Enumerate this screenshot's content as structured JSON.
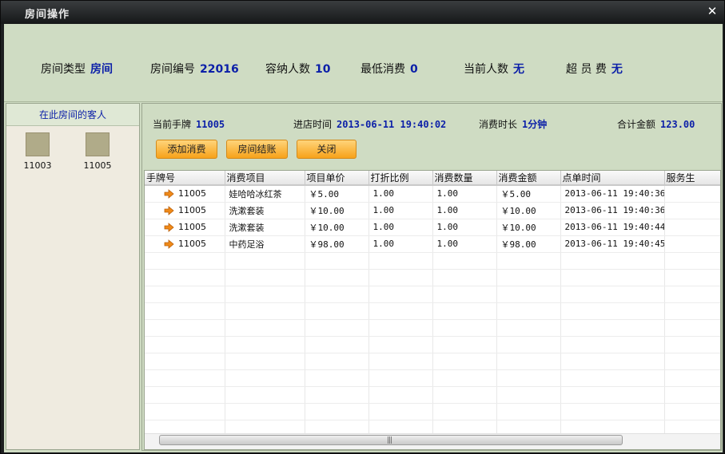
{
  "window": {
    "title": "房间操作",
    "close_glyph": "✕"
  },
  "room_info": {
    "type_label": "房间类型",
    "type_value": "房间",
    "number_label": "房间编号",
    "number_value": "22016",
    "capacity_label": "容纳人数",
    "capacity_value": "10",
    "min_spend_label": "最低消费",
    "min_spend_value": "0",
    "current_people_label": "当前人数",
    "current_people_value": "无",
    "overage_label": "超 员 费",
    "overage_value": "无"
  },
  "guests": {
    "header": "在此房间的客人",
    "items": [
      {
        "id": "11003"
      },
      {
        "id": "11005"
      }
    ]
  },
  "current": {
    "card_label": "当前手牌",
    "card_value": "11005",
    "checkin_label": "进店时间",
    "checkin_value": "2013-06-11 19:40:02",
    "duration_label": "消费时长",
    "duration_value": "1分钟",
    "total_label": "合计金额",
    "total_value": "123.00"
  },
  "buttons": {
    "add": "添加消费",
    "checkout": "房间结账",
    "close": "关闭"
  },
  "table": {
    "columns": [
      "手牌号",
      "消费项目",
      "项目单价",
      "打折比例",
      "消费数量",
      "消费金额",
      "点单时间",
      "服务生"
    ],
    "rows": [
      {
        "card": "11005",
        "item": "娃哈哈冰红茶",
        "price": "￥5.00",
        "discount": "1.00",
        "qty": "1.00",
        "amount": "￥5.00",
        "time": "2013-06-11 19:40:36",
        "waiter": ""
      },
      {
        "card": "11005",
        "item": "洗漱套装",
        "price": "￥10.00",
        "discount": "1.00",
        "qty": "1.00",
        "amount": "￥10.00",
        "time": "2013-06-11 19:40:36",
        "waiter": ""
      },
      {
        "card": "11005",
        "item": "洗漱套装",
        "price": "￥10.00",
        "discount": "1.00",
        "qty": "1.00",
        "amount": "￥10.00",
        "time": "2013-06-11 19:40:44",
        "waiter": ""
      },
      {
        "card": "11005",
        "item": "中药足浴",
        "price": "￥98.00",
        "discount": "1.00",
        "qty": "1.00",
        "amount": "￥98.00",
        "time": "2013-06-11 19:40:45",
        "waiter": ""
      }
    ],
    "scroll_grip": "|||"
  },
  "colors": {
    "accent_value": "#0b1fa8",
    "button": "#f7a21a",
    "background": "#cfdcc3"
  },
  "icons": {
    "row_marker": "arrow-right-icon",
    "close": "close-icon"
  }
}
